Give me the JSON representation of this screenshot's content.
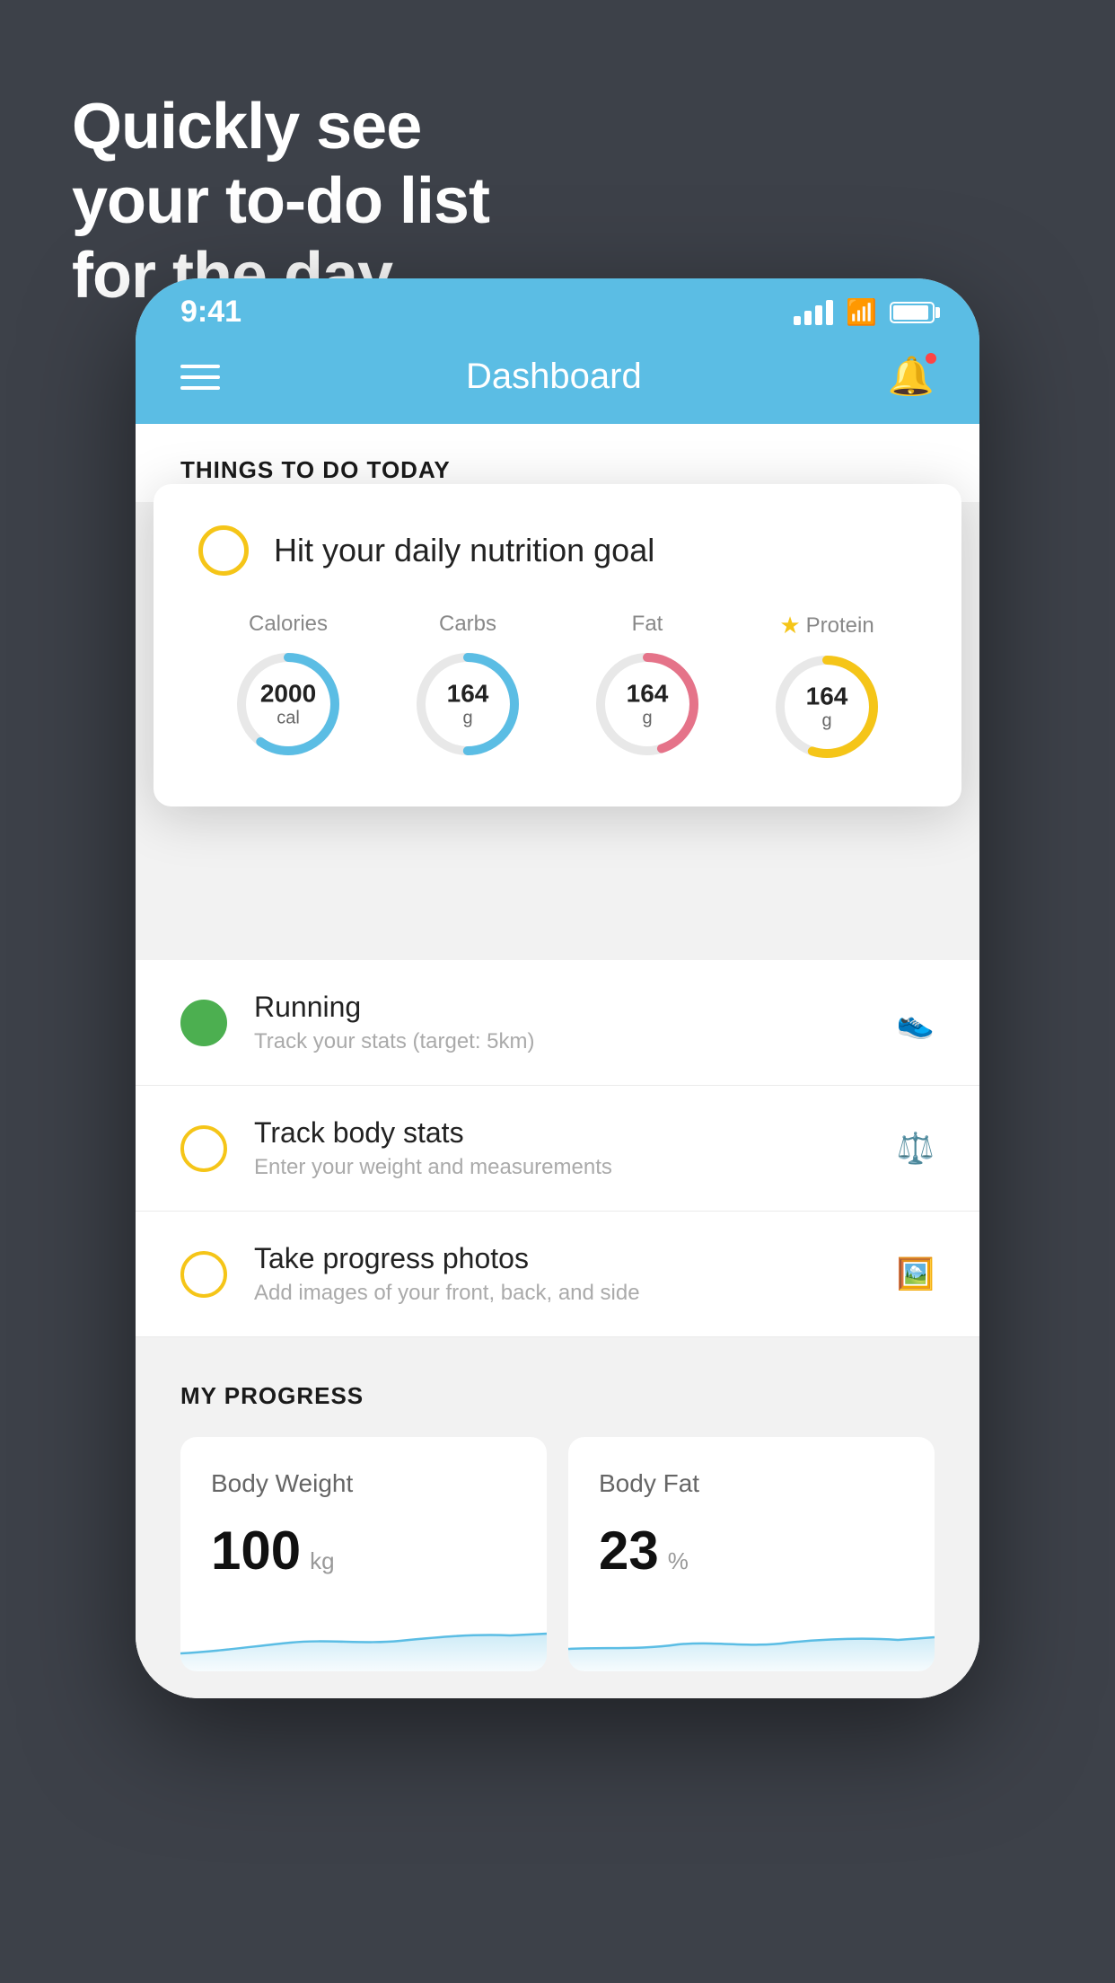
{
  "page": {
    "background_color": "#3d4149",
    "headline_line1": "Quickly see",
    "headline_line2": "your to-do list",
    "headline_line3": "for the day."
  },
  "status_bar": {
    "time": "9:41",
    "background": "#5bbde4"
  },
  "nav": {
    "title": "Dashboard",
    "background": "#5bbde4"
  },
  "things_section": {
    "header": "THINGS TO DO TODAY"
  },
  "nutrition_card": {
    "title": "Hit your daily nutrition goal",
    "macros": [
      {
        "label": "Calories",
        "value": "2000",
        "unit": "cal",
        "color": "blue",
        "progress": 0.6
      },
      {
        "label": "Carbs",
        "value": "164",
        "unit": "g",
        "color": "blue",
        "progress": 0.5
      },
      {
        "label": "Fat",
        "value": "164",
        "unit": "g",
        "color": "pink",
        "progress": 0.45
      },
      {
        "label": "Protein",
        "value": "164",
        "unit": "g",
        "color": "yellow",
        "progress": 0.55,
        "starred": true
      }
    ]
  },
  "todo_items": [
    {
      "title": "Running",
      "subtitle": "Track your stats (target: 5km)",
      "status": "complete",
      "circle_color": "green",
      "icon": "shoe"
    },
    {
      "title": "Track body stats",
      "subtitle": "Enter your weight and measurements",
      "status": "incomplete",
      "circle_color": "yellow",
      "icon": "scale"
    },
    {
      "title": "Take progress photos",
      "subtitle": "Add images of your front, back, and side",
      "status": "incomplete",
      "circle_color": "yellow",
      "icon": "photo"
    }
  ],
  "progress": {
    "header": "MY PROGRESS",
    "cards": [
      {
        "title": "Body Weight",
        "value": "100",
        "unit": "kg"
      },
      {
        "title": "Body Fat",
        "value": "23",
        "unit": "%"
      }
    ]
  }
}
